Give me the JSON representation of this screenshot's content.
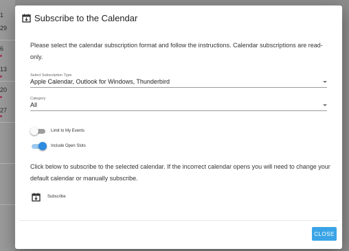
{
  "background": {
    "side_numbers": [
      "1",
      "29",
      "6",
      "13",
      "20",
      "27"
    ]
  },
  "dialog": {
    "title": "Subscribe to the Calendar",
    "title_icon": "calendar-download-icon",
    "intro": "Please select the calendar subscription format and follow the instructions. Calendar subscriptions are read-only.",
    "subscription_type": {
      "label": "Select Subscription Type",
      "value": "Apple Calendar, Outlook for Windows, Thunderbird"
    },
    "category": {
      "label": "Category",
      "value": "All"
    },
    "toggles": [
      {
        "label": "Limit to My Events",
        "on": false
      },
      {
        "label": "Include Open Slots",
        "on": true
      }
    ],
    "instructions": "Click below to subscribe to the selected calendar. If the incorrect calendar opens you will need to change your default calendar or manually subscribe.",
    "subscribe_label": "Subscribe",
    "subscribe_icon": "calendar-download-icon",
    "close_label": "CLOSE"
  },
  "colors": {
    "accent": "#3aa4e6",
    "toggle_on": "#2d8be0"
  }
}
